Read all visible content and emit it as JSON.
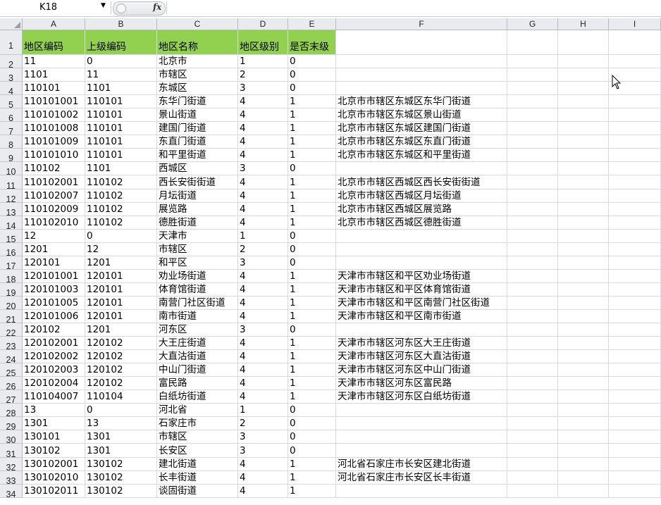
{
  "formula_bar": {
    "name_box": "K18",
    "fx_label": "fx",
    "formula": ""
  },
  "columns": [
    "A",
    "B",
    "C",
    "D",
    "E",
    "F",
    "G",
    "H",
    "I"
  ],
  "header_row": {
    "row_number": "1",
    "cells": [
      "地区编码",
      "上级编码",
      "地区名称",
      "地区级别",
      "是否末级"
    ]
  },
  "rows": [
    {
      "n": "2",
      "a": "11",
      "b": "0",
      "c": "北京市",
      "d": "1",
      "e": "0",
      "f": ""
    },
    {
      "n": "3",
      "a": "1101",
      "b": "11",
      "c": "市辖区",
      "d": "2",
      "e": "0",
      "f": ""
    },
    {
      "n": "4",
      "a": "110101",
      "b": "1101",
      "c": "东城区",
      "d": "3",
      "e": "0",
      "f": ""
    },
    {
      "n": "5",
      "a": "110101001",
      "b": "110101",
      "c": "东华门街道",
      "d": "4",
      "e": "1",
      "f": "北京市市辖区东城区东华门街道"
    },
    {
      "n": "6",
      "a": "110101002",
      "b": "110101",
      "c": "景山街道",
      "d": "4",
      "e": "1",
      "f": "北京市市辖区东城区景山街道"
    },
    {
      "n": "7",
      "a": "110101008",
      "b": "110101",
      "c": "建国门街道",
      "d": "4",
      "e": "1",
      "f": "北京市市辖区东城区建国门街道"
    },
    {
      "n": "8",
      "a": "110101009",
      "b": "110101",
      "c": "东直门街道",
      "d": "4",
      "e": "1",
      "f": "北京市市辖区东城区东直门街道"
    },
    {
      "n": "9",
      "a": "110101010",
      "b": "110101",
      "c": "和平里街道",
      "d": "4",
      "e": "1",
      "f": "北京市市辖区东城区和平里街道"
    },
    {
      "n": "10",
      "a": "110102",
      "b": "1101",
      "c": "西城区",
      "d": "3",
      "e": "0",
      "f": ""
    },
    {
      "n": "11",
      "a": "110102001",
      "b": "110102",
      "c": "西长安街街道",
      "d": "4",
      "e": "1",
      "f": "北京市市辖区西城区西长安街街道"
    },
    {
      "n": "12",
      "a": "110102007",
      "b": "110102",
      "c": "月坛街道",
      "d": "4",
      "e": "1",
      "f": "北京市市辖区西城区月坛街道"
    },
    {
      "n": "13",
      "a": "110102009",
      "b": "110102",
      "c": "展览路",
      "d": "4",
      "e": "1",
      "f": "北京市市辖区西城区展览路"
    },
    {
      "n": "14",
      "a": "110102010",
      "b": "110102",
      "c": "德胜街道",
      "d": "4",
      "e": "1",
      "f": "北京市市辖区西城区德胜街道"
    },
    {
      "n": "15",
      "a": "12",
      "b": "0",
      "c": "天津市",
      "d": "1",
      "e": "0",
      "f": ""
    },
    {
      "n": "16",
      "a": "1201",
      "b": "12",
      "c": "市辖区",
      "d": "2",
      "e": "0",
      "f": ""
    },
    {
      "n": "17",
      "a": "120101",
      "b": "1201",
      "c": "和平区",
      "d": "3",
      "e": "0",
      "f": ""
    },
    {
      "n": "18",
      "a": "120101001",
      "b": "120101",
      "c": "劝业场街道",
      "d": "4",
      "e": "1",
      "f": "天津市市辖区和平区劝业场街道"
    },
    {
      "n": "19",
      "a": "120101003",
      "b": "120101",
      "c": "体育馆街道",
      "d": "4",
      "e": "1",
      "f": "天津市市辖区和平区体育馆街道"
    },
    {
      "n": "20",
      "a": "120101005",
      "b": "120101",
      "c": "南营门社区街道",
      "d": "4",
      "e": "1",
      "f": "天津市市辖区和平区南营门社区街道"
    },
    {
      "n": "21",
      "a": "120101006",
      "b": "120101",
      "c": "南市街道",
      "d": "4",
      "e": "1",
      "f": "天津市市辖区和平区南市街道"
    },
    {
      "n": "22",
      "a": "120102",
      "b": "1201",
      "c": "河东区",
      "d": "3",
      "e": "0",
      "f": ""
    },
    {
      "n": "23",
      "a": "120102001",
      "b": "120102",
      "c": "大王庄街道",
      "d": "4",
      "e": "1",
      "f": "天津市市辖区河东区大王庄街道"
    },
    {
      "n": "24",
      "a": "120102002",
      "b": "120102",
      "c": "大直沽街道",
      "d": "4",
      "e": "1",
      "f": "天津市市辖区河东区大直沽街道"
    },
    {
      "n": "25",
      "a": "120102003",
      "b": "120102",
      "c": "中山门街道",
      "d": "4",
      "e": "1",
      "f": "天津市市辖区河东区中山门街道"
    },
    {
      "n": "26",
      "a": "120102004",
      "b": "120102",
      "c": "富民路",
      "d": "4",
      "e": "1",
      "f": "天津市市辖区河东区富民路"
    },
    {
      "n": "27",
      "a": "110104007",
      "b": "110104",
      "c": "白纸坊街道",
      "d": "4",
      "e": "1",
      "f": "天津市市辖区河东区白纸坊街道"
    },
    {
      "n": "28",
      "a": "13",
      "b": "0",
      "c": "河北省",
      "d": "1",
      "e": "0",
      "f": ""
    },
    {
      "n": "29",
      "a": "1301",
      "b": "13",
      "c": "石家庄市",
      "d": "2",
      "e": "0",
      "f": ""
    },
    {
      "n": "30",
      "a": "130101",
      "b": "1301",
      "c": "市辖区",
      "d": "3",
      "e": "0",
      "f": ""
    },
    {
      "n": "31",
      "a": "130102",
      "b": "1301",
      "c": "长安区",
      "d": "3",
      "e": "0",
      "f": ""
    },
    {
      "n": "32",
      "a": "130102001",
      "b": "130102",
      "c": "建北街道",
      "d": "4",
      "e": "1",
      "f": "河北省石家庄市长安区建北街道"
    },
    {
      "n": "33",
      "a": "130102010",
      "b": "130102",
      "c": "长丰街道",
      "d": "4",
      "e": "1",
      "f": "河北省石家庄市长安区长丰街道"
    },
    {
      "n": "34",
      "a": "130102011",
      "b": "130102",
      "c": "谈固街道",
      "d": "4",
      "e": "1",
      "f": ""
    }
  ],
  "colors": {
    "header_fill": "#92d050",
    "grid_line": "#d6d9dd",
    "header_bg": "#e9ebee"
  }
}
